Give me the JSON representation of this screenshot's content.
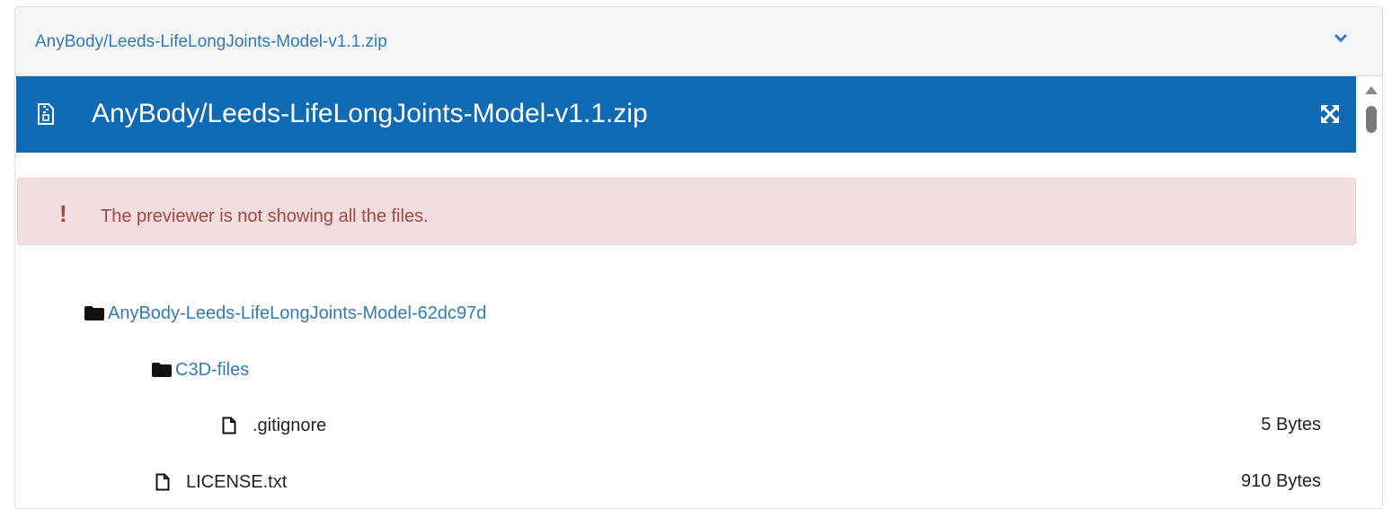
{
  "panel": {
    "header_title": "AnyBody/Leeds-LifeLongJoints-Model-v1.1.zip",
    "collapse_icon": "chevron-down-icon"
  },
  "viewer": {
    "title": "AnyBody/Leeds-LifeLongJoints-Model-v1.1.zip",
    "title_icon": "zip-file-icon",
    "fullscreen_icon": "expand-icon",
    "accent_color": "#0f6ab4"
  },
  "alert": {
    "icon": "!",
    "message": "The previewer is not showing all the files."
  },
  "tree": {
    "root_folder": "AnyBody-Leeds-LifeLongJoints-Model-62dc97d",
    "subfolder": "C3D-files",
    "files": [
      {
        "name": ".gitignore",
        "size": "5 Bytes"
      },
      {
        "name": "LICENSE.txt",
        "size": "910 Bytes"
      }
    ]
  }
}
